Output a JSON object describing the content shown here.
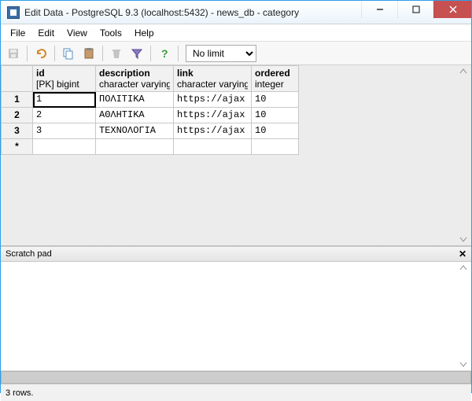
{
  "window": {
    "title": "Edit Data - PostgreSQL 9.3 (localhost:5432) - news_db - category"
  },
  "menu": {
    "file": "File",
    "edit": "Edit",
    "view": "View",
    "tools": "Tools",
    "help": "Help"
  },
  "toolbar": {
    "limit_value": "No limit"
  },
  "columns": [
    {
      "name": "id",
      "type": "[PK] bigint"
    },
    {
      "name": "description",
      "type": "character varying"
    },
    {
      "name": "link",
      "type": "character varying"
    },
    {
      "name": "ordered",
      "type": "integer"
    }
  ],
  "rows": [
    {
      "n": "1",
      "id": "1",
      "description": "ΠΟΛΙΤΙΚΑ",
      "link": "https://ajax",
      "ordered": "10"
    },
    {
      "n": "2",
      "id": "2",
      "description": "ΑΘΛΗΤΙΚΑ",
      "link": "https://ajax",
      "ordered": "10"
    },
    {
      "n": "3",
      "id": "3",
      "description": "ΤΕΧΝΟΛΟΓΙΑ",
      "link": "https://ajax",
      "ordered": "10"
    }
  ],
  "new_row_marker": "*",
  "scratch": {
    "title": "Scratch pad"
  },
  "status": {
    "text": "3 rows."
  },
  "chart_data": {
    "type": "table",
    "title": "category",
    "columns": [
      "id",
      "description",
      "link",
      "ordered"
    ],
    "rows": [
      [
        1,
        "ΠΟΛΙΤΙΚΑ",
        "https://ajax",
        10
      ],
      [
        2,
        "ΑΘΛΗΤΙΚΑ",
        "https://ajax",
        10
      ],
      [
        3,
        "ΤΕΧΝΟΛΟΓΙΑ",
        "https://ajax",
        10
      ]
    ]
  }
}
